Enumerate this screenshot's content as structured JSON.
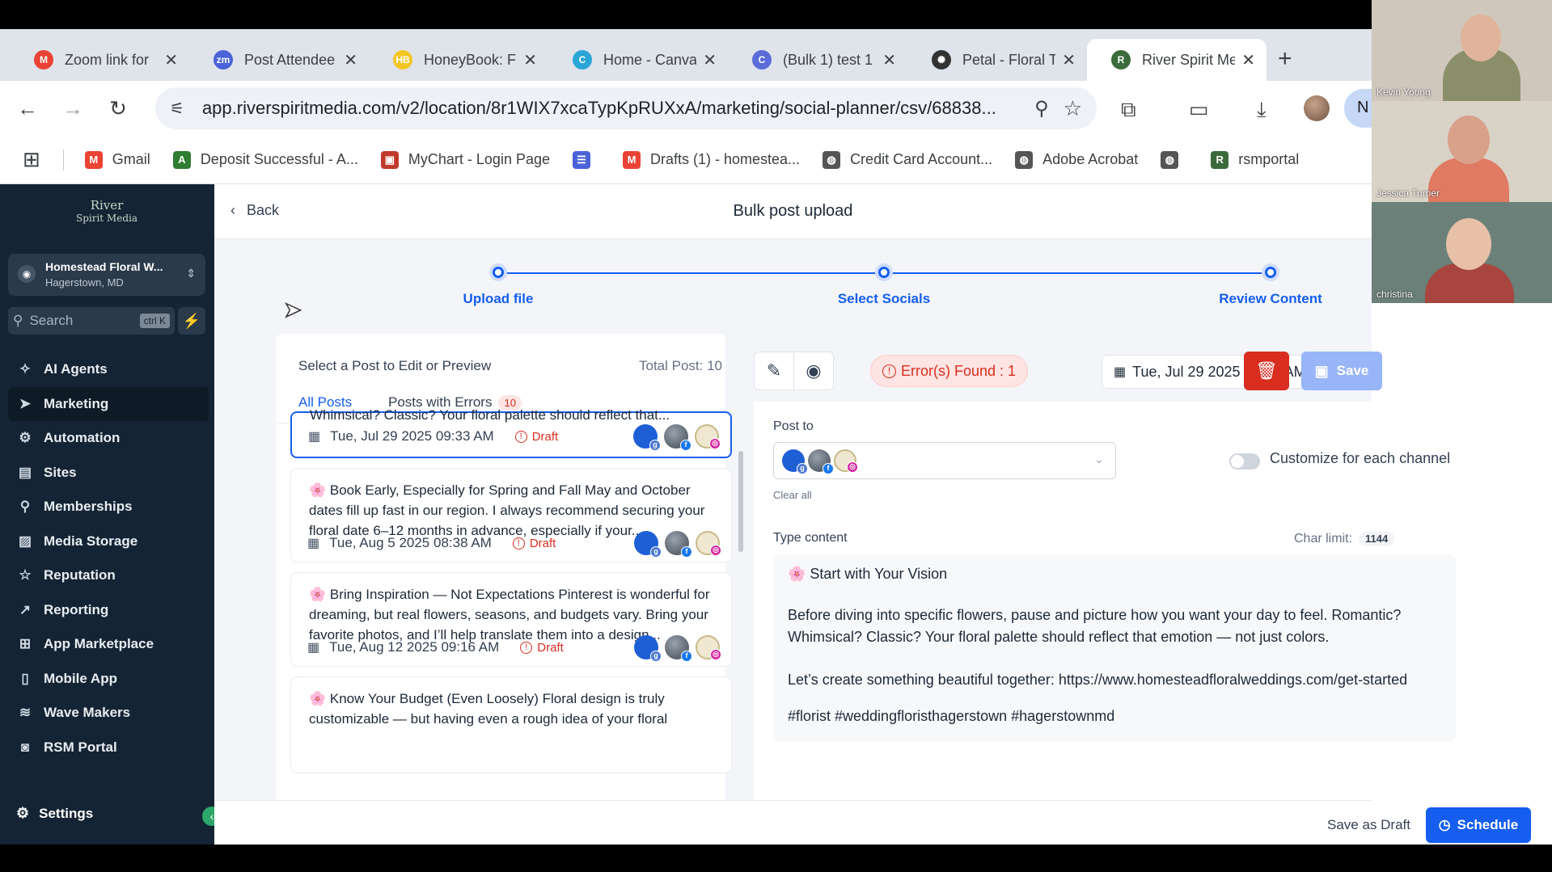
{
  "browser": {
    "tabs": [
      {
        "label": "Zoom link for",
        "icon": "gmail-icon",
        "color": "#ea4335",
        "glyph": "M"
      },
      {
        "label": "Post Attendee",
        "icon": "zoom-icon",
        "color": "#4a63d8",
        "glyph": "zm"
      },
      {
        "label": "HoneyBook: Fl",
        "icon": "honeybook-icon",
        "color": "#f3c623",
        "glyph": "HB"
      },
      {
        "label": "Home - Canva",
        "icon": "canva-icon",
        "color": "#2aa6d8",
        "glyph": "C"
      },
      {
        "label": "(Bulk 1) test 1",
        "icon": "canva-icon",
        "color": "#5b6cd8",
        "glyph": "C"
      },
      {
        "label": "Petal - Floral T",
        "icon": "openai-icon",
        "color": "#333333",
        "glyph": "✺"
      },
      {
        "label": "River Spirit Me",
        "icon": "riverspirit-icon",
        "color": "#3b6b3b",
        "glyph": "R"
      }
    ],
    "url": "app.riverspiritmedia.com/v2/location/8r1WIX7xcaTypKpRUXxA/marketing/social-planner/csv/68838...",
    "profile_initial": "N",
    "bookmarks": [
      {
        "label": "Gmail",
        "color": "#ea4335",
        "glyph": "M"
      },
      {
        "label": "Deposit Successful - A...",
        "color": "#2e7d32",
        "glyph": "A"
      },
      {
        "label": "MyChart - Login Page",
        "color": "#c0392b",
        "glyph": "▣"
      },
      {
        "label": "",
        "color": "#4a63d8",
        "glyph": "☰"
      },
      {
        "label": "Drafts (1) - homestea...",
        "color": "#ea4335",
        "glyph": "M"
      },
      {
        "label": "Credit Card Account...",
        "color": "#555555",
        "glyph": "◍"
      },
      {
        "label": "Adobe Acrobat",
        "color": "#555555",
        "glyph": "◍"
      },
      {
        "label": "",
        "color": "#555555",
        "glyph": "◍"
      },
      {
        "label": "rsmportal",
        "color": "#3b6b3b",
        "glyph": "R"
      }
    ]
  },
  "video": {
    "participants": [
      "Kevin Young",
      "Jessica Turner",
      "christina"
    ]
  },
  "sidebar": {
    "logo_line1": "River",
    "logo_line2": "Spirit Media",
    "location_name": "Homestead Floral W...",
    "location_city": "Hagerstown, MD",
    "search_placeholder": "Search",
    "search_shortcut": "ctrl K",
    "items": [
      {
        "label": "AI Agents",
        "icon": "✧"
      },
      {
        "label": "Marketing",
        "icon": "➤"
      },
      {
        "label": "Automation",
        "icon": "⚙"
      },
      {
        "label": "Sites",
        "icon": "▤"
      },
      {
        "label": "Memberships",
        "icon": "⚲"
      },
      {
        "label": "Media Storage",
        "icon": "▨"
      },
      {
        "label": "Reputation",
        "icon": "☆"
      },
      {
        "label": "Reporting",
        "icon": "↗"
      },
      {
        "label": "App Marketplace",
        "icon": "⊞"
      },
      {
        "label": "Mobile App",
        "icon": "▯"
      },
      {
        "label": "Wave Makers",
        "icon": "≋"
      },
      {
        "label": "RSM Portal",
        "icon": "◙"
      }
    ],
    "settings_label": "Settings"
  },
  "header": {
    "back_label": "Back",
    "title": "Bulk post upload"
  },
  "stepper": {
    "steps": [
      "Upload file",
      "Select Socials",
      "Review Content"
    ]
  },
  "posts_panel": {
    "title": "Select a Post to Edit or Preview",
    "total": "Total Post: 10",
    "tab_all": "All Posts",
    "tab_errors": "Posts with Errors",
    "error_count": "10",
    "posts": [
      {
        "text": "Whimsical? Classic? Your floral palette should reflect that...",
        "date": "Tue, Jul 29 2025 09:33 AM",
        "status": "Draft"
      },
      {
        "text": "🌸 Book Early, Especially for Spring and Fall May and October dates fill up fast in our region. I always recommend securing your floral date 6–12 months in advance, especially if your...",
        "date": "Tue, Aug 5 2025 08:38 AM",
        "status": "Draft"
      },
      {
        "text": "🌸 Bring Inspiration — Not Expectations Pinterest is wonderful for dreaming, but real flowers, seasons, and budgets vary. Bring your favorite photos, and I’ll help translate them into a design...",
        "date": "Tue, Aug 12 2025 09:16 AM",
        "status": "Draft"
      },
      {
        "text": "🌸 Know Your Budget (Even Loosely) Floral design is truly customizable — but having even a rough idea of your floral",
        "date": "",
        "status": ""
      }
    ]
  },
  "editor": {
    "errors_label": "Error(s) Found : 1",
    "date_label": "Tue, Jul 29 2025 09:33 AM",
    "save_label": "Save",
    "post_to_label": "Post to",
    "clear_all": "Clear all",
    "customize_label": "Customize for each channel",
    "type_content_label": "Type content",
    "char_limit_label": "Char limit:",
    "char_limit_value": "1144",
    "content_heading": "🌸 Start with Your Vision",
    "content_p1": "Before diving into specific flowers, pause and picture how you want your day to feel. Romantic? Whimsical? Classic? Your floral palette should reflect that emotion — not just colors.",
    "content_p2": "Let’s create something beautiful together: https://www.homesteadfloralweddings.com/get-started",
    "content_p3": "#florist #weddingfloristhagerstown #hagerstownmd"
  },
  "footer": {
    "save_draft": "Save as Draft",
    "schedule": "Schedule"
  }
}
